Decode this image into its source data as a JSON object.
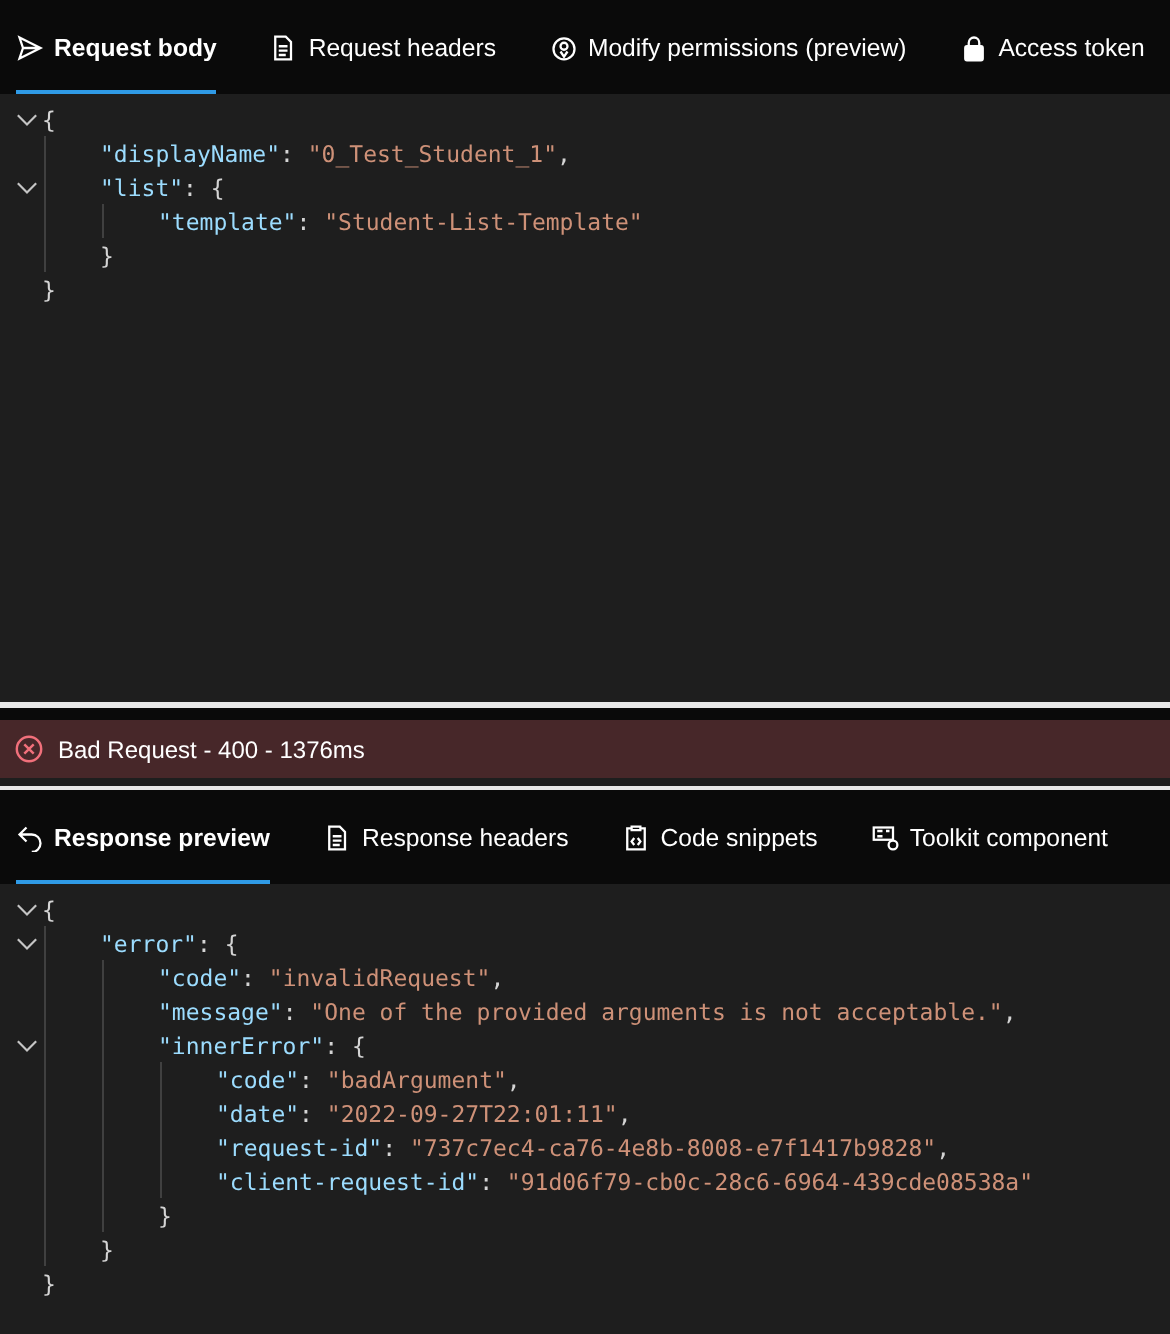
{
  "request_tabs": [
    {
      "label": "Request body",
      "selected": true
    },
    {
      "label": "Request headers",
      "selected": false
    },
    {
      "label": "Modify permissions (preview)",
      "selected": false
    },
    {
      "label": "Access token",
      "selected": false
    }
  ],
  "request_body": {
    "tokens": [
      {
        "kind": "punct",
        "text": "{"
      }
    ],
    "expanded": true,
    "close": [
      {
        "kind": "punct",
        "text": "}"
      }
    ],
    "children": [
      {
        "tokens": [
          {
            "kind": "key",
            "text": "\"displayName\""
          },
          {
            "kind": "punct",
            "text": ": "
          },
          {
            "kind": "string",
            "text": "\"0_Test_Student_1\""
          },
          {
            "kind": "punct",
            "text": ","
          }
        ]
      },
      {
        "tokens": [
          {
            "kind": "key",
            "text": "\"list\""
          },
          {
            "kind": "punct",
            "text": ": {"
          }
        ],
        "expanded": true,
        "close": [
          {
            "kind": "punct",
            "text": "}"
          }
        ],
        "children": [
          {
            "tokens": [
              {
                "kind": "key",
                "text": "\"template\""
              },
              {
                "kind": "punct",
                "text": ": "
              },
              {
                "kind": "string",
                "text": "\"Student-List-Template\""
              }
            ]
          }
        ]
      }
    ]
  },
  "status": {
    "text": "Bad Request - 400 - 1376ms",
    "kind": "error"
  },
  "response_tabs": [
    {
      "label": "Response preview",
      "selected": true
    },
    {
      "label": "Response headers",
      "selected": false
    },
    {
      "label": "Code snippets",
      "selected": false
    },
    {
      "label": "Toolkit component",
      "selected": false
    }
  ],
  "response_body": {
    "tokens": [
      {
        "kind": "punct",
        "text": "{"
      }
    ],
    "expanded": true,
    "close": [
      {
        "kind": "punct",
        "text": "}"
      }
    ],
    "children": [
      {
        "tokens": [
          {
            "kind": "key",
            "text": "\"error\""
          },
          {
            "kind": "punct",
            "text": ": {"
          }
        ],
        "expanded": true,
        "close": [
          {
            "kind": "punct",
            "text": "}"
          }
        ],
        "children": [
          {
            "tokens": [
              {
                "kind": "key",
                "text": "\"code\""
              },
              {
                "kind": "punct",
                "text": ": "
              },
              {
                "kind": "string",
                "text": "\"invalidRequest\""
              },
              {
                "kind": "punct",
                "text": ","
              }
            ]
          },
          {
            "tokens": [
              {
                "kind": "key",
                "text": "\"message\""
              },
              {
                "kind": "punct",
                "text": ": "
              },
              {
                "kind": "string",
                "text": "\"One of the provided arguments is not acceptable.\""
              },
              {
                "kind": "punct",
                "text": ","
              }
            ]
          },
          {
            "tokens": [
              {
                "kind": "key",
                "text": "\"innerError\""
              },
              {
                "kind": "punct",
                "text": ": {"
              }
            ],
            "expanded": true,
            "close": [
              {
                "kind": "punct",
                "text": "}"
              }
            ],
            "children": [
              {
                "tokens": [
                  {
                    "kind": "key",
                    "text": "\"code\""
                  },
                  {
                    "kind": "punct",
                    "text": ": "
                  },
                  {
                    "kind": "string",
                    "text": "\"badArgument\""
                  },
                  {
                    "kind": "punct",
                    "text": ","
                  }
                ]
              },
              {
                "tokens": [
                  {
                    "kind": "key",
                    "text": "\"date\""
                  },
                  {
                    "kind": "punct",
                    "text": ": "
                  },
                  {
                    "kind": "string",
                    "text": "\"2022-09-27T22:01:11\""
                  },
                  {
                    "kind": "punct",
                    "text": ","
                  }
                ]
              },
              {
                "tokens": [
                  {
                    "kind": "key",
                    "text": "\"request-id\""
                  },
                  {
                    "kind": "punct",
                    "text": ": "
                  },
                  {
                    "kind": "string",
                    "text": "\"737c7ec4-ca76-4e8b-8008-e7f1417b9828\""
                  },
                  {
                    "kind": "punct",
                    "text": ","
                  }
                ]
              },
              {
                "tokens": [
                  {
                    "kind": "key",
                    "text": "\"client-request-id\""
                  },
                  {
                    "kind": "punct",
                    "text": ": "
                  },
                  {
                    "kind": "string",
                    "text": "\"91d06f79-cb0c-28c6-6964-439cde08538a\""
                  }
                ]
              }
            ]
          }
        ]
      }
    ]
  }
}
